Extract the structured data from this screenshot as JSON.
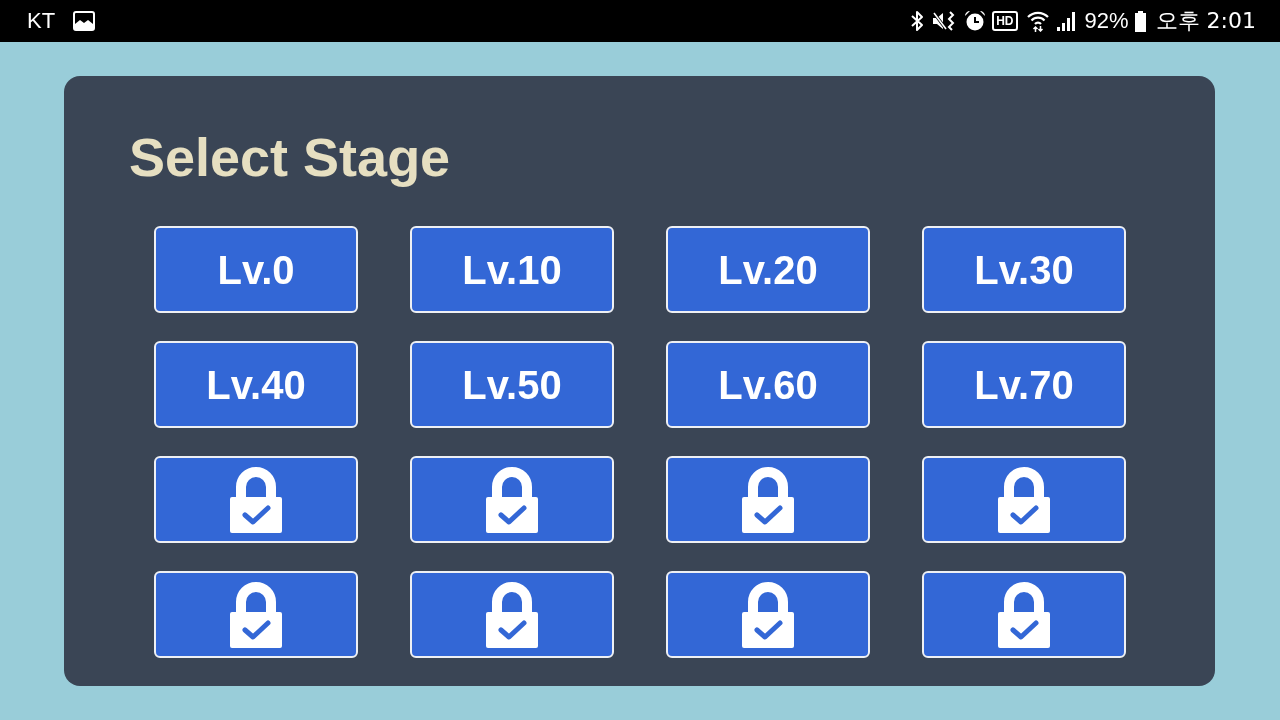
{
  "status_bar": {
    "carrier": "KT",
    "hd": "HD",
    "battery_percent": "92%",
    "time": "오후 2:01"
  },
  "title": "Select Stage",
  "stages": [
    {
      "kind": "level",
      "label": "Lv.0"
    },
    {
      "kind": "level",
      "label": "Lv.10"
    },
    {
      "kind": "level",
      "label": "Lv.20"
    },
    {
      "kind": "level",
      "label": "Lv.30"
    },
    {
      "kind": "level",
      "label": "Lv.40"
    },
    {
      "kind": "level",
      "label": "Lv.50"
    },
    {
      "kind": "level",
      "label": "Lv.60"
    },
    {
      "kind": "level",
      "label": "Lv.70"
    },
    {
      "kind": "locked"
    },
    {
      "kind": "locked"
    },
    {
      "kind": "locked"
    },
    {
      "kind": "locked"
    },
    {
      "kind": "locked"
    },
    {
      "kind": "locked"
    },
    {
      "kind": "locked"
    },
    {
      "kind": "locked"
    }
  ]
}
